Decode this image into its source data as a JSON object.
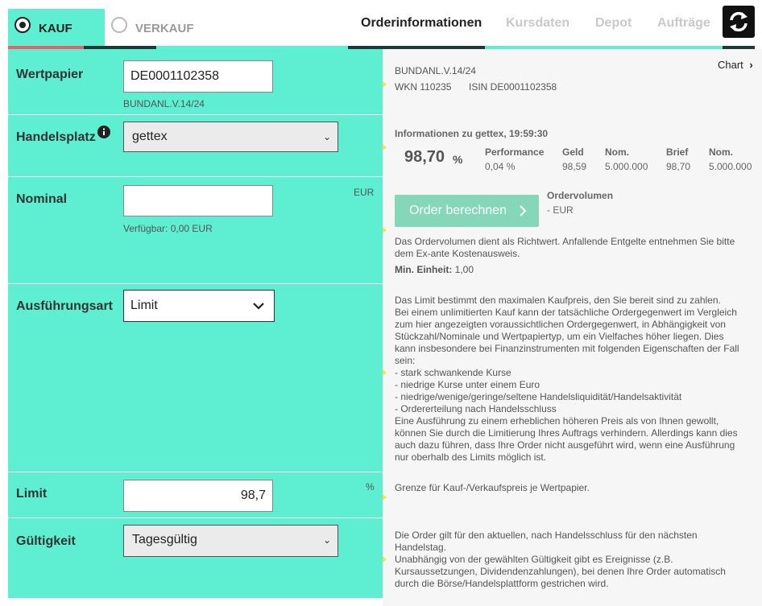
{
  "tabs": {
    "kauf": "KAUF",
    "verkauf": "VERKAUF"
  },
  "nav": {
    "orderinfo": "Orderinformationen",
    "kursdaten": "Kursdaten",
    "depot": "Depot",
    "auftraege": "Aufträge"
  },
  "form": {
    "wertpapier": {
      "label": "Wertpapier",
      "value": "DE0001102358",
      "caption": "BUNDANL.V.14/24"
    },
    "handelsplatz": {
      "label": "Handelsplatz",
      "value": "gettex"
    },
    "nominal": {
      "label": "Nominal",
      "value": "",
      "unit": "EUR",
      "caption": "Verfügbar: 0,00 EUR"
    },
    "ausfuehrungsart": {
      "label": "Ausführungsart",
      "value": "Limit"
    },
    "limit": {
      "label": "Limit",
      "value": "98,7",
      "unit": "%"
    },
    "gueltigkeit": {
      "label": "Gültigkeit",
      "value": "Tagesgültig"
    }
  },
  "info": {
    "chart_link": "Chart",
    "name": "BUNDANL.V.14/24",
    "wkn": "WKN 110235",
    "isin": "ISIN DE0001102358",
    "quote_title": "Informationen zu gettex, 19:59:30",
    "price": "98,70",
    "price_unit": "%",
    "cols": [
      {
        "head": "Performance",
        "val": "0,04 %"
      },
      {
        "head": "Geld",
        "val": "98,59"
      },
      {
        "head": "Nom.",
        "val": "5.000.000"
      },
      {
        "head": "Brief",
        "val": "98,70"
      },
      {
        "head": "Nom.",
        "val": "5.000.000"
      }
    ],
    "button": "Order berechnen",
    "ordervolumen_label": "Ordervolumen",
    "ordervolumen_value": "- EUR",
    "volumen_note_1": "Das Ordervolumen dient als Richtwert. Anfallende Entgelte entnehmen Sie bitte",
    "volumen_note_2": "dem Ex-ante Kostenausweis.",
    "min_label": "Min. Einheit:",
    "min_value": "1,00",
    "limit_text": [
      "Das Limit bestimmt den maximalen Kaufpreis, den Sie bereit sind zu zahlen.",
      "Bei einem unlimitierten Kauf kann der tatsächliche Ordergegenwert im Vergleich",
      "zum hier angezeigten voraussichtlichen Ordergegenwert, in Abhängigkeit von",
      "Stückzahl/Nominale und Wertpapiertyp, um ein Vielfaches höher liegen. Dies",
      "kann insbesondere bei Finanzinstrumenten mit folgenden Eigenschaften der Fall",
      "sein:",
      "- stark schwankende Kurse",
      "- niedrige Kurse unter einem Euro",
      "- niedrige/wenige/geringe/seltene Handelsliquidität/Handelsaktivität",
      "- Ordererteilung nach Handelsschluss",
      "Eine Ausführung zu einem erheblichen höheren Preis als von Ihnen gewollt,",
      "können Sie durch die Limitierung Ihres Auftrags verhindern. Allerdings kann dies",
      "auch dazu führen, dass Ihre Order nicht ausgeführt wird, wenn eine Ausführung",
      "nur oberhalb des Limits möglich ist."
    ],
    "limit_hint": "Grenze für Kauf-/Verkaufspreis je Wertpapier.",
    "gueltigkeit_text": [
      "Die Order gilt für den aktuellen, nach Handelsschluss für den nächsten",
      "Handelstag.",
      "Unabhängig von der gewählten Gültigkeit gibt es Ereignisse (z.B.",
      "Kursaussetzungen, Dividendenzahlungen), bei denen Ihre Order automatisch",
      "durch die Börse/Handelsplattform gestrichen wird."
    ]
  },
  "colors": {
    "accent": "#5eeed1",
    "button": "#86d6b9",
    "bar_red": "#e8606a",
    "bar_dark": "#1b3a35"
  },
  "icons": [
    "radio-checked-icon",
    "radio-unchecked-icon",
    "refresh-icon",
    "info-icon",
    "chevron-down-icon",
    "chevron-right-icon"
  ]
}
